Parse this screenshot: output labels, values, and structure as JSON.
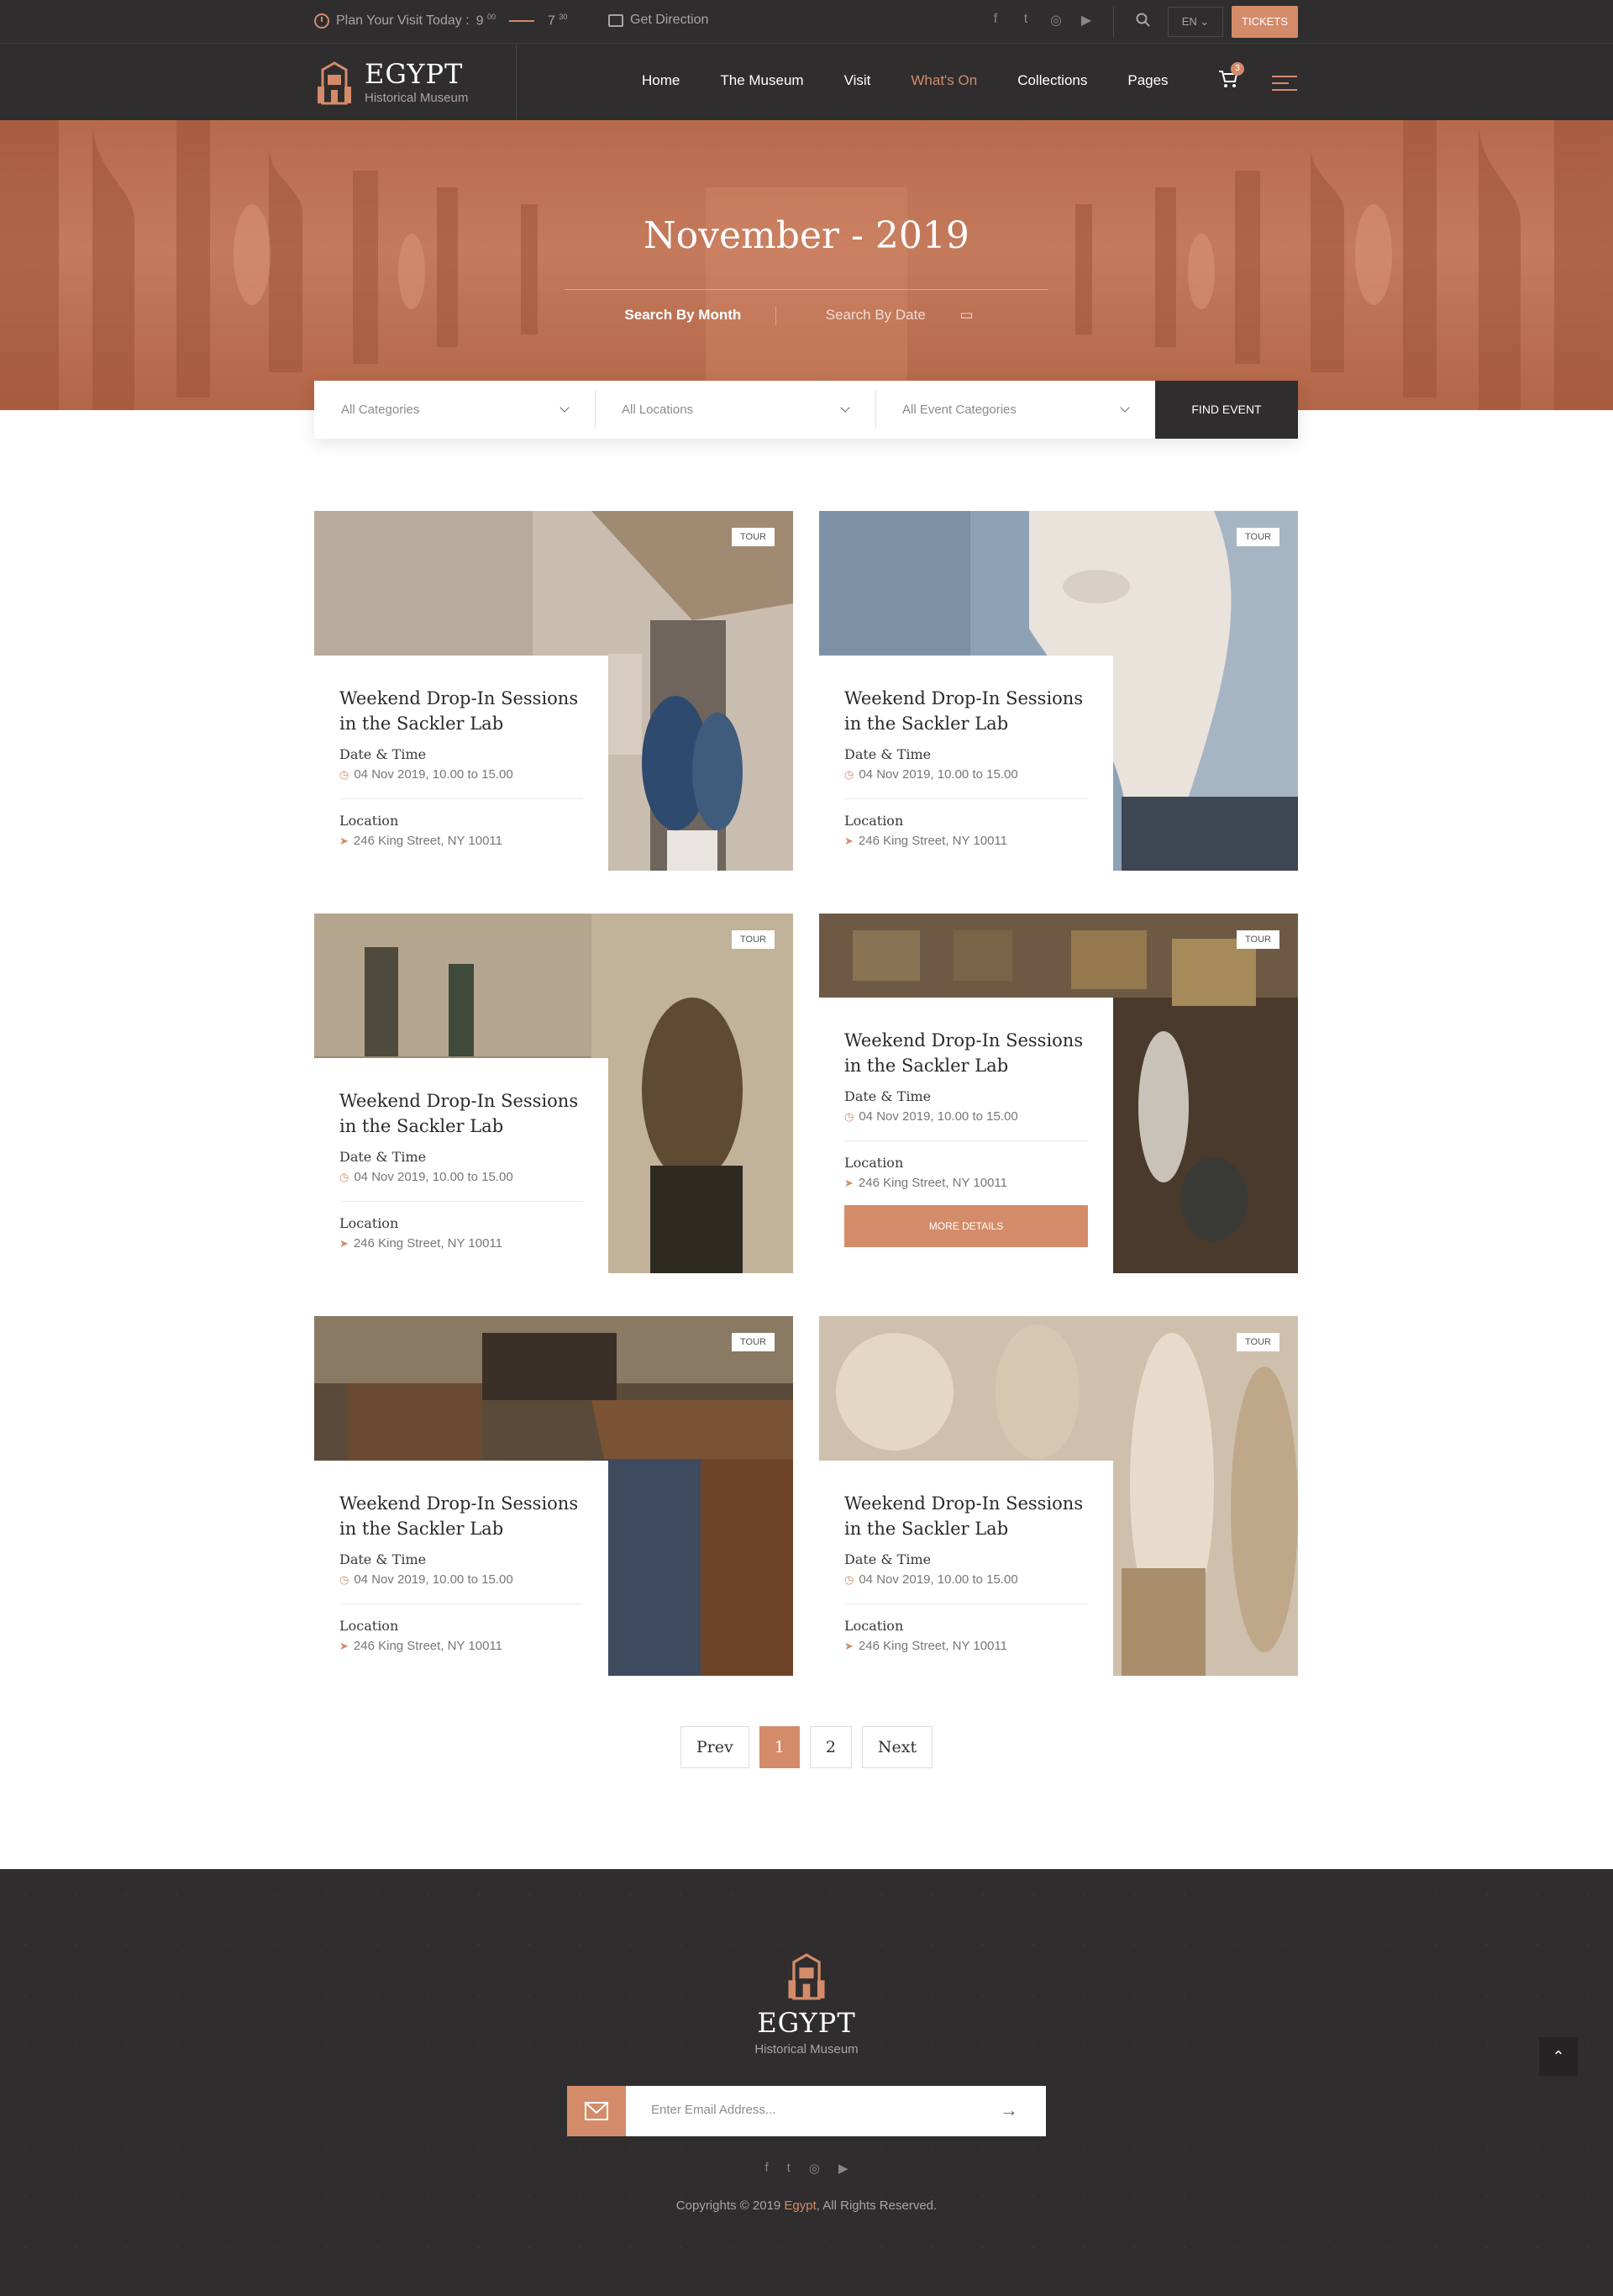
{
  "topbar": {
    "plan_label": "Plan Your Visit Today :",
    "open_hour": "9",
    "open_min": "00",
    "close_hour": "7",
    "close_min": "30",
    "direction_label": "Get Direction",
    "social": [
      "f",
      "t",
      "◎",
      "▶"
    ],
    "language": "EN",
    "tickets_label": "TICKETS"
  },
  "brand": {
    "title": "EGYPT",
    "subtitle": "Historical Museum"
  },
  "nav": {
    "items": [
      {
        "label": "Home",
        "active": false
      },
      {
        "label": "The Museum",
        "active": false
      },
      {
        "label": "Visit",
        "active": false
      },
      {
        "label": "What's On",
        "active": true
      },
      {
        "label": "Collections",
        "active": false
      },
      {
        "label": "Pages",
        "active": false
      }
    ],
    "cart_count": "3"
  },
  "hero": {
    "title": "November - 2019",
    "tab_month": "Search By Month",
    "tab_date": "Search By Date"
  },
  "filter": {
    "categories": "All Categories",
    "locations": "All Locations",
    "event_categories": "All Event Categories",
    "find_label": "FIND EVENT"
  },
  "events": {
    "tag": "TOUR",
    "items": [
      {
        "title": "Weekend Drop-In Sessions in the Sackler Lab",
        "date_label": "Date & Time",
        "date": "04 Nov 2019, 10.00 to 15.00",
        "location_label": "Location",
        "location": "246 King Street, NY 10011"
      },
      {
        "title": "Weekend Drop-In Sessions in the Sackler Lab",
        "date_label": "Date & Time",
        "date": "04 Nov 2019, 10.00 to 15.00",
        "location_label": "Location",
        "location": "246 King Street, NY 10011"
      },
      {
        "title": "Weekend Drop-In Sessions in the Sackler Lab",
        "date_label": "Date & Time",
        "date": "04 Nov 2019, 10.00 to 15.00",
        "location_label": "Location",
        "location": "246 King Street, NY 10011"
      },
      {
        "title": "Weekend Drop-In Sessions in the Sackler Lab",
        "date_label": "Date & Time",
        "date": "04 Nov 2019, 10.00 to 15.00",
        "location_label": "Location",
        "location": "246 King Street, NY 10011",
        "more_label": "MORE DETAILS"
      },
      {
        "title": "Weekend Drop-In Sessions in the Sackler Lab",
        "date_label": "Date & Time",
        "date": "04 Nov 2019, 10.00 to 15.00",
        "location_label": "Location",
        "location": "246 King Street, NY 10011"
      },
      {
        "title": "Weekend Drop-In Sessions in the Sackler Lab",
        "date_label": "Date & Time",
        "date": "04 Nov 2019, 10.00 to 15.00",
        "location_label": "Location",
        "location": "246 King Street, NY 10011"
      }
    ]
  },
  "pagination": {
    "prev": "Prev",
    "pages": [
      "1",
      "2"
    ],
    "current": "1",
    "next": "Next"
  },
  "footer": {
    "title": "EGYPT",
    "subtitle": "Historical Museum",
    "email_placeholder": "Enter Email Address...",
    "social": [
      "f",
      "t",
      "◎",
      "▶"
    ],
    "copyright_prefix": "Copyrights © 2019 ",
    "copyright_brand": "Egypt",
    "copyright_suffix": ", All Rights Reserved."
  },
  "colors": {
    "accent": "#d48b6a",
    "dark": "#2f2d2e"
  }
}
